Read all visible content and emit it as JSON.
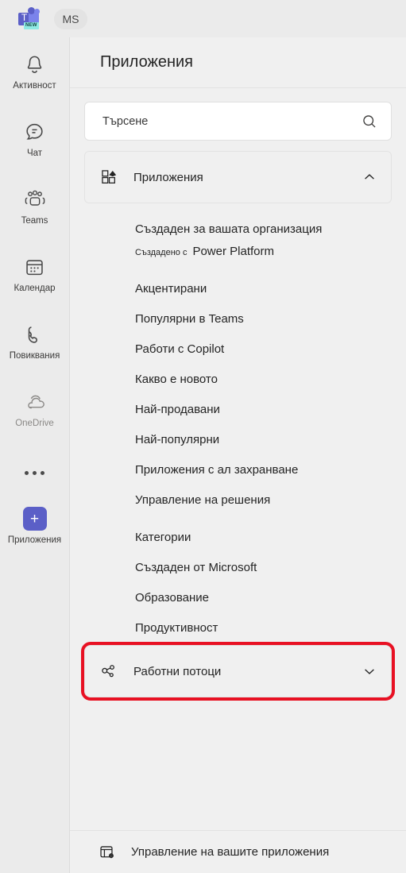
{
  "titlebar": {
    "app_logo": "teams-logo",
    "new_badge": "NEW",
    "avatar_initials": "MS"
  },
  "rail": {
    "items": [
      {
        "label": "Активност",
        "icon": "bell-icon",
        "dim": false
      },
      {
        "label": "Чат",
        "icon": "chat-icon",
        "dim": false
      },
      {
        "label": "Teams",
        "icon": "teams-people-icon",
        "dim": false
      },
      {
        "label": "Календар",
        "icon": "calendar-icon",
        "dim": false
      },
      {
        "label": "Повиквания",
        "icon": "phone-icon",
        "dim": false
      },
      {
        "label": "OneDrive",
        "icon": "cloud-icon",
        "dim": true
      }
    ],
    "more_icon": "more-dots-icon",
    "apps": {
      "label": "Приложения",
      "icon": "plus-icon",
      "accent": "#5b5fc7"
    }
  },
  "panel": {
    "title": "Приложения",
    "search": {
      "placeholder": "Търсене",
      "value": "",
      "icon": "search-icon"
    },
    "apps_section": {
      "label": "Приложения",
      "icon": "apps-grid-icon",
      "chevron": "chevron-up-icon",
      "expanded": true
    },
    "list": {
      "org_item": "Създаден за вашата организация",
      "built_with_prefix": "Създадено с",
      "built_with_name": "Power Platform",
      "group_one": [
        "Акцентирани",
        "Популярни в Teams",
        "Работи с Copilot",
        "Какво е новото",
        "Най-продавани",
        "Най-популярни",
        "Приложения с ал захранване",
        "Управление на решения"
      ],
      "group_two": [
        "Категории",
        "Създаден от Microsoft",
        "Образование",
        "Продуктивност"
      ]
    },
    "workflows_section": {
      "label": "Работни потоци",
      "icon": "workflow-share-icon",
      "chevron": "chevron-down-icon",
      "expanded": false,
      "highlight_color": "#e81123"
    },
    "manage_apps": {
      "label": "Управление на вашите приложения",
      "icon": "manage-apps-icon"
    }
  }
}
